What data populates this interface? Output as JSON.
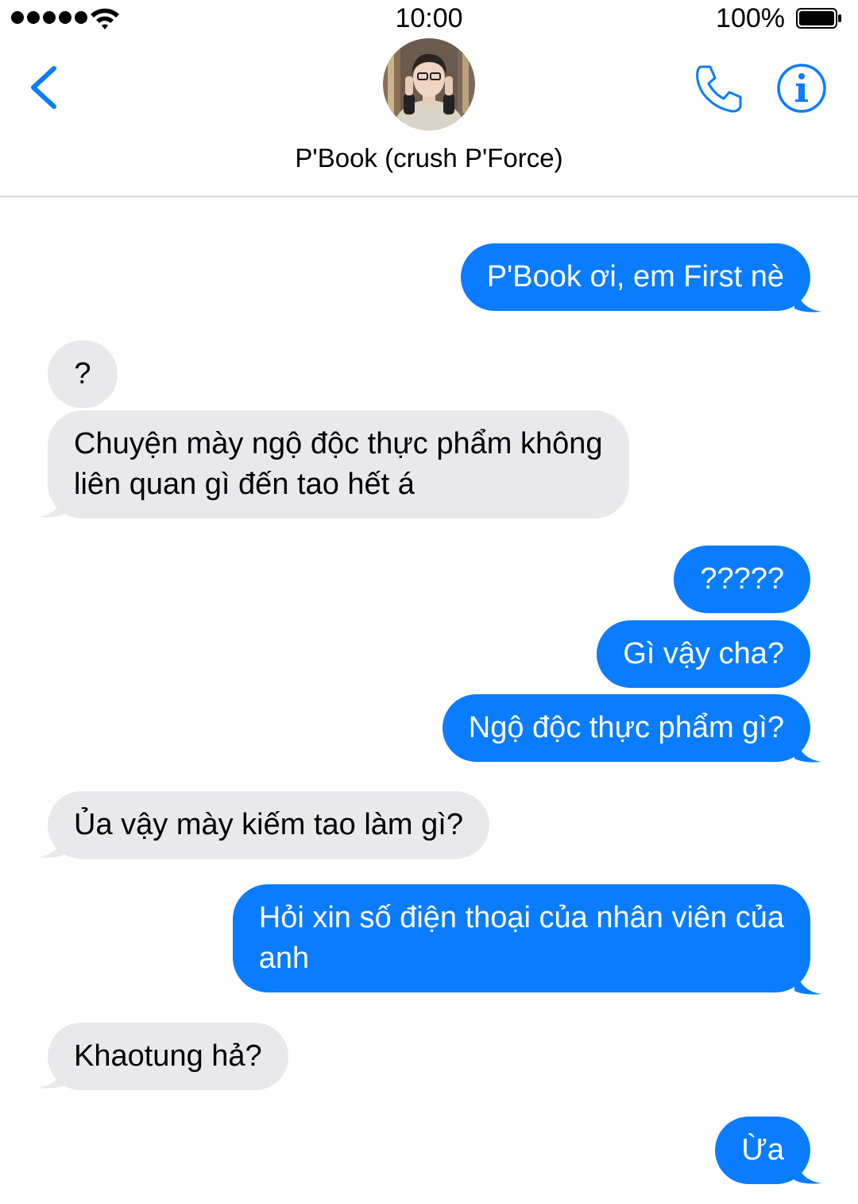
{
  "status_bar": {
    "time": "10:00",
    "battery": "100%"
  },
  "header": {
    "contact_name": "P'Book (crush P'Force)"
  },
  "colors": {
    "accent": "#0a7cff",
    "incoming_bubble": "#e9e9eb"
  },
  "messages": [
    {
      "direction": "outgoing",
      "text": "P'Book ơi, em First nè"
    },
    {
      "direction": "incoming",
      "text": "?"
    },
    {
      "direction": "incoming",
      "text": "Chuyện mày ngộ độc thực phẩm không\nliên quan gì đến tao hết á"
    },
    {
      "direction": "outgoing",
      "text": "?????"
    },
    {
      "direction": "outgoing",
      "text": "Gì vậy cha?"
    },
    {
      "direction": "outgoing",
      "text": "Ngộ độc thực phẩm gì?"
    },
    {
      "direction": "incoming",
      "text": "Ủa vậy mày kiếm tao làm gì?"
    },
    {
      "direction": "outgoing",
      "text": "Hỏi xin số điện thoại của nhân viên của\nanh"
    },
    {
      "direction": "incoming",
      "text": "Khaotung hả?"
    },
    {
      "direction": "outgoing",
      "text": "Ừa"
    }
  ]
}
